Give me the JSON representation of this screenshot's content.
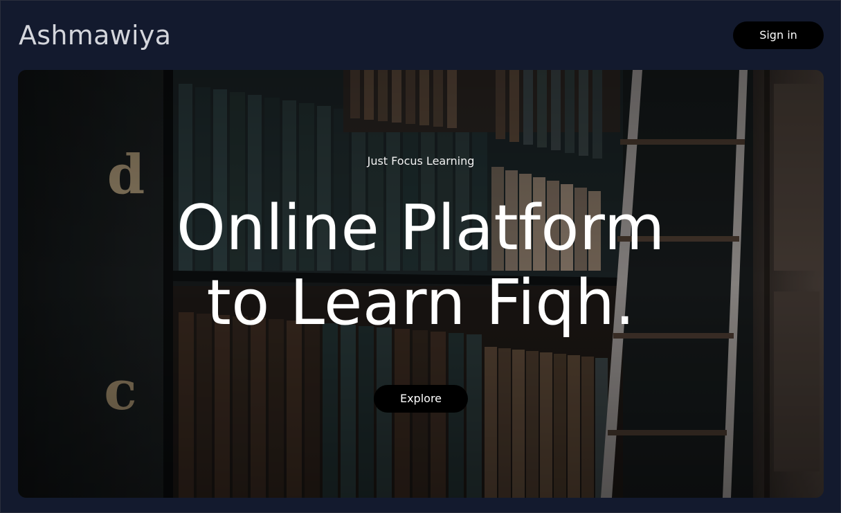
{
  "header": {
    "brand": "Ashmawiya",
    "signin_label": "Sign in"
  },
  "hero": {
    "eyebrow": "Just Focus Learning",
    "headline_line1": "Online Platform",
    "headline_line2": "to Learn Fiqh.",
    "explore_label": "Explore",
    "shelf_letters": [
      "d",
      "c"
    ]
  },
  "colors": {
    "page_background": "#131a2e",
    "button_background": "#000000",
    "button_text": "#ffffff",
    "brand_text": "#d4d6dc"
  }
}
